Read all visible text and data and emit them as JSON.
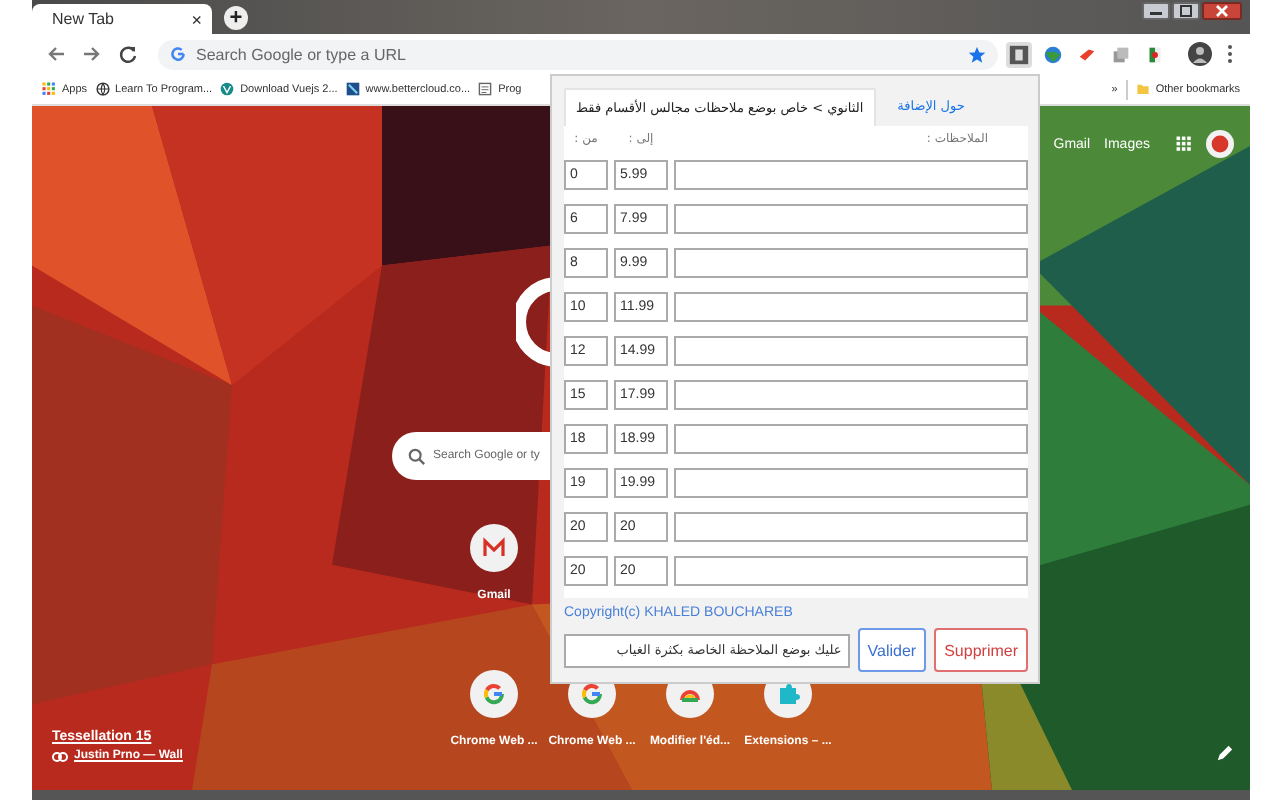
{
  "browser": {
    "tab": {
      "title": "New Tab",
      "close": "×"
    },
    "new_tab": "+",
    "omnibox": {
      "placeholder": "Search Google or type a URL"
    },
    "bookmarks": [
      {
        "label": "Apps",
        "kind": "apps"
      },
      {
        "label": "Learn To Program...",
        "kind": "globe"
      },
      {
        "label": "Download Vuejs 2...",
        "kind": "vue"
      },
      {
        "label": "www.bettercloud.co...",
        "kind": "cloud"
      },
      {
        "label": "Prog",
        "kind": "page"
      }
    ],
    "overflow": "»",
    "other_bookmarks": "Other bookmarks"
  },
  "new_tab_page": {
    "header_links": [
      "Gmail",
      "Images"
    ],
    "search": {
      "placeholder": "Search Google or ty"
    },
    "shortcut_rows": [
      [
        {
          "label": "Gmail",
          "kind": "gmail"
        }
      ],
      [
        {
          "label": "Chrome Web ...",
          "kind": "google"
        },
        {
          "label": "Chrome Web ...",
          "kind": "google"
        },
        {
          "label": "Modifier l'éd...",
          "kind": "rainbow"
        },
        {
          "label": "Extensions – ...",
          "kind": "puzzle"
        }
      ]
    ],
    "credit": {
      "title": "Tessellation 15",
      "author": "Justin Prno — Wall"
    }
  },
  "popup": {
    "tabs": [
      {
        "label": "حول الإضافة",
        "selected": false
      },
      {
        "label": "الثانوي > خاص بوضع ملاحظات مجالس الأقسام فقط",
        "selected": true
      }
    ],
    "headers": {
      "from": "من :",
      "to": "إلى :",
      "notes": "الملاحظات :"
    },
    "rows": [
      {
        "from": "0",
        "to": "5.99"
      },
      {
        "from": "6",
        "to": "7.99"
      },
      {
        "from": "8",
        "to": "9.99"
      },
      {
        "from": "10",
        "to": "11.99"
      },
      {
        "from": "12",
        "to": "14.99"
      },
      {
        "from": "15",
        "to": "17.99"
      },
      {
        "from": "18",
        "to": "18.99"
      },
      {
        "from": "19",
        "to": "19.99"
      },
      {
        "from": "20",
        "to": "20"
      },
      {
        "from": "20",
        "to": "20"
      }
    ],
    "copyright": "Copyright(c) KHALED BOUCHAREB",
    "note": {
      "value": "عليك بوضع الملاحظة الخاصة بكثرة الغياب"
    },
    "buttons": [
      {
        "label": "Valider",
        "kind": "primary"
      },
      {
        "label": "Supprimer",
        "kind": "danger"
      }
    ]
  }
}
